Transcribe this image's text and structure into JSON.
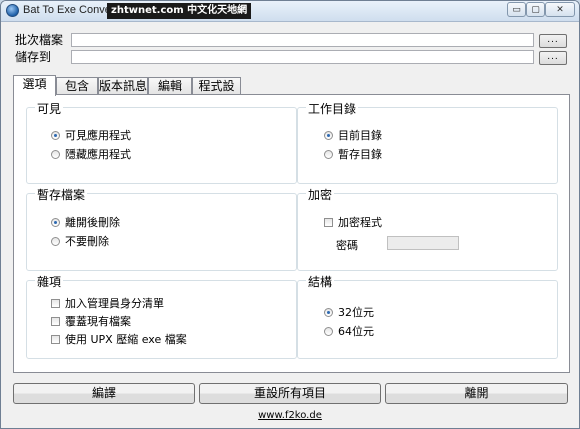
{
  "window": {
    "title": "Bat To Exe Converter",
    "watermark": "zhtwnet.com 中文化天地網"
  },
  "caption_buttons": {
    "minimize": "▭",
    "maximize": "▢",
    "close": "✕"
  },
  "fields": {
    "batch_file_label": "批次檔案",
    "save_to_label": "儲存到",
    "batch_file_value": "",
    "save_to_value": "",
    "browse_label": "..."
  },
  "tabs": [
    {
      "label": "選項",
      "active": true
    },
    {
      "label": "包含"
    },
    {
      "label": "版本訊息"
    },
    {
      "label": "編輯"
    },
    {
      "label": "程式設定"
    }
  ],
  "groups": {
    "visibility": {
      "title": "可見",
      "options": [
        {
          "label": "可見應用程式",
          "selected": true
        },
        {
          "label": "隱藏應用程式",
          "selected": false
        }
      ]
    },
    "working_dir": {
      "title": "工作目錄",
      "options": [
        {
          "label": "目前目錄",
          "selected": true
        },
        {
          "label": "暫存目錄",
          "selected": false
        }
      ]
    },
    "temp_files": {
      "title": "暫存檔案",
      "options": [
        {
          "label": "離開後刪除",
          "selected": true
        },
        {
          "label": "不要刪除",
          "selected": false
        }
      ]
    },
    "encryption": {
      "title": "加密",
      "checkbox": {
        "label": "加密程式",
        "checked": false
      },
      "password_label": "密碼",
      "password_value": ""
    },
    "misc": {
      "title": "雜項",
      "checkboxes": [
        {
          "label": "加入管理員身分清單",
          "checked": false
        },
        {
          "label": "覆蓋現有檔案",
          "checked": false
        },
        {
          "label": "使用 UPX 壓縮 exe 檔案",
          "checked": false
        }
      ]
    },
    "architecture": {
      "title": "結構",
      "options": [
        {
          "label": "32位元",
          "selected": true
        },
        {
          "label": "64位元",
          "selected": false
        }
      ]
    }
  },
  "buttons": {
    "compile": "編譯",
    "reset": "重設所有項目",
    "exit": "離開"
  },
  "footer": {
    "link": "www.f2ko.de"
  }
}
